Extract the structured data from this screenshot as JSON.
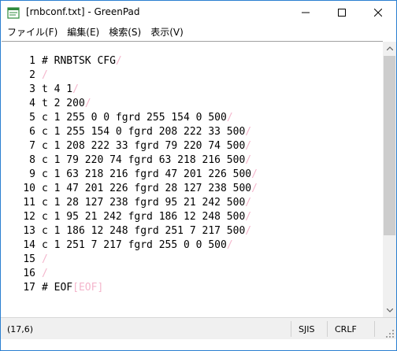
{
  "window": {
    "title": "[rnbconf.txt] - GreenPad"
  },
  "menu": {
    "items": [
      "ファイル(F)",
      "編集(E)",
      "検索(S)",
      "表示(V)"
    ]
  },
  "editor": {
    "eol_mark": "/",
    "eof_mark": "[EOF]",
    "lines": [
      {
        "num": "1",
        "text": "# RNBTSK CFG"
      },
      {
        "num": "2",
        "text": ""
      },
      {
        "num": "3",
        "text": "t 4 1"
      },
      {
        "num": "4",
        "text": "t 2 200"
      },
      {
        "num": "5",
        "text": "c 1 255 0 0 fgrd 255 154 0 500"
      },
      {
        "num": "6",
        "text": "c 1 255 154 0 fgrd 208 222 33 500"
      },
      {
        "num": "7",
        "text": "c 1 208 222 33 fgrd 79 220 74 500"
      },
      {
        "num": "8",
        "text": "c 1 79 220 74 fgrd 63 218 216 500"
      },
      {
        "num": "9",
        "text": "c 1 63 218 216 fgrd 47 201 226 500"
      },
      {
        "num": "10",
        "text": "c 1 47 201 226 fgrd 28 127 238 500"
      },
      {
        "num": "11",
        "text": "c 1 28 127 238 fgrd 95 21 242 500"
      },
      {
        "num": "12",
        "text": "c 1 95 21 242 fgrd 186 12 248 500"
      },
      {
        "num": "13",
        "text": "c 1 186 12 248 fgrd 251 7 217 500"
      },
      {
        "num": "14",
        "text": "c 1 251 7 217 fgrd 255 0 0 500"
      },
      {
        "num": "15",
        "text": ""
      },
      {
        "num": "16",
        "text": ""
      },
      {
        "num": "17",
        "text": "# EOF"
      }
    ]
  },
  "status": {
    "position": "(17,6)",
    "encoding": "SJIS",
    "line_ending": "CRLF"
  },
  "colors": {
    "eol_mark": "#f4b6cc",
    "title_border": "#2b7fd0",
    "app_icon": "#2e8b3d"
  }
}
